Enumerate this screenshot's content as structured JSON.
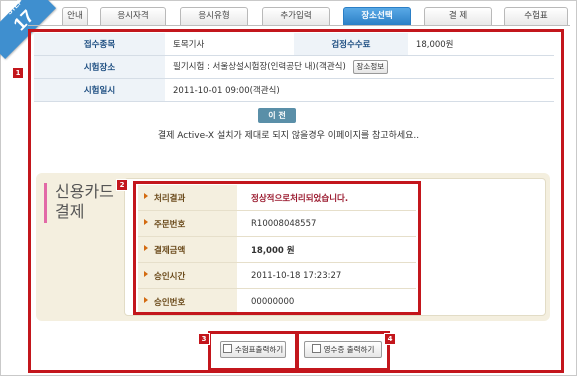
{
  "step": {
    "label": "STEP",
    "number": "17"
  },
  "tabs": [
    {
      "label": "접수안내",
      "visible": "안내"
    },
    {
      "label": "응시자격"
    },
    {
      "label": "응시유형"
    },
    {
      "label": "추가입력"
    },
    {
      "label": "장소선택",
      "active": true
    },
    {
      "label": "결 제"
    },
    {
      "label": "수험표"
    }
  ],
  "badges": [
    "1",
    "2",
    "3",
    "4"
  ],
  "info": {
    "exam_type_label": "접수종목",
    "exam_type_value": "토목기사",
    "fee_label": "검정수수료",
    "fee_value": "18,000원",
    "place_label": "시험장소",
    "place_value": "필기시험 : 서울상설시험장(인력공단 내)(객관식)",
    "place_button": "장소정보",
    "date_label": "시험일시",
    "date_value": "2011-10-01 09:00(객관식)"
  },
  "prev_button": "이 전",
  "notice": "결제 Active-X 설치가 제대로 되지 않을경우 이페이지를 참고하세요..",
  "card": {
    "title_line1": "신용카드",
    "title_line2": "결제",
    "rows": [
      {
        "label": "처리결과",
        "value": "정상적으로처리되었습니다."
      },
      {
        "label": "주문번호",
        "value": "R10008048557"
      },
      {
        "label": "결제금액",
        "value": "18,000 원"
      },
      {
        "label": "승인시간",
        "value": "2011-10-18 17:23:27"
      },
      {
        "label": "승인번호",
        "value": "00000000"
      }
    ]
  },
  "buttons": {
    "print_ticket": "수험표출력하기",
    "print_receipt": "영수증 출력하기"
  },
  "colors": {
    "highlight_red": "#c3161c",
    "active_tab": "#2b7fc6",
    "step_ribbon": "#3f8fcf"
  }
}
